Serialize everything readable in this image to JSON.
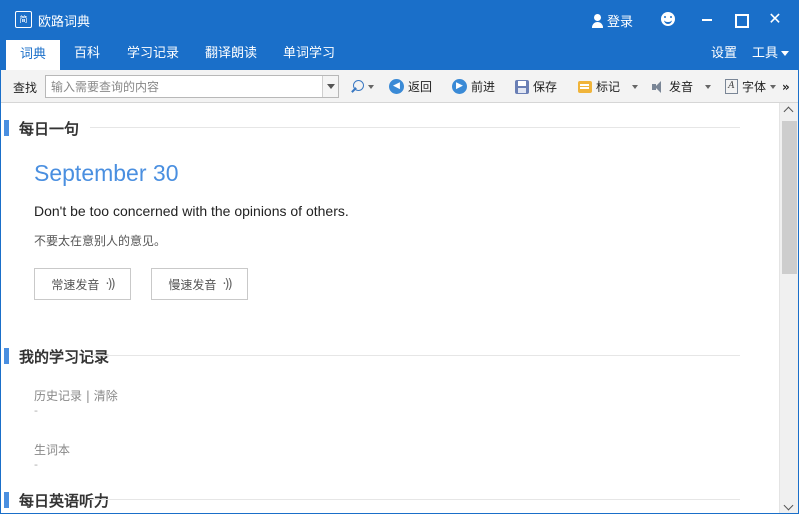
{
  "window": {
    "app_icon_text": "简",
    "title": "欧路词典",
    "login_label": "登录"
  },
  "tabs": [
    {
      "label": "词典",
      "active": true
    },
    {
      "label": "百科",
      "active": false
    },
    {
      "label": "学习记录",
      "active": false
    },
    {
      "label": "翻译朗读",
      "active": false
    },
    {
      "label": "单词学习",
      "active": false
    }
  ],
  "tabbar_right": {
    "settings_label": "设置",
    "tools_label": "工具"
  },
  "toolbar": {
    "search_label": "查找",
    "search_placeholder": "输入需要查询的内容",
    "search_value": "",
    "back_label": "返回",
    "forward_label": "前进",
    "save_label": "保存",
    "mark_label": "标记",
    "pronounce_label": "发音",
    "font_label": "字体",
    "overflow_label": "»"
  },
  "daily_sentence": {
    "section_title": "每日一句",
    "date": "September 30",
    "english": "Don't be too concerned with the opinions of others.",
    "chinese": "不要太在意别人的意见。",
    "normal_speed_label": "常速发音",
    "slow_speed_label": "慢速发音"
  },
  "study_record": {
    "section_title": "我的学习记录",
    "history_label": "历史记录",
    "separator": "|",
    "clear_label": "清除",
    "history_value": "-",
    "vocab_label": "生词本",
    "vocab_value": "-"
  },
  "listening": {
    "section_title": "每日英语听力"
  },
  "colors": {
    "brand_blue": "#1a6fc9",
    "accent_blue": "#4a8fe0"
  }
}
